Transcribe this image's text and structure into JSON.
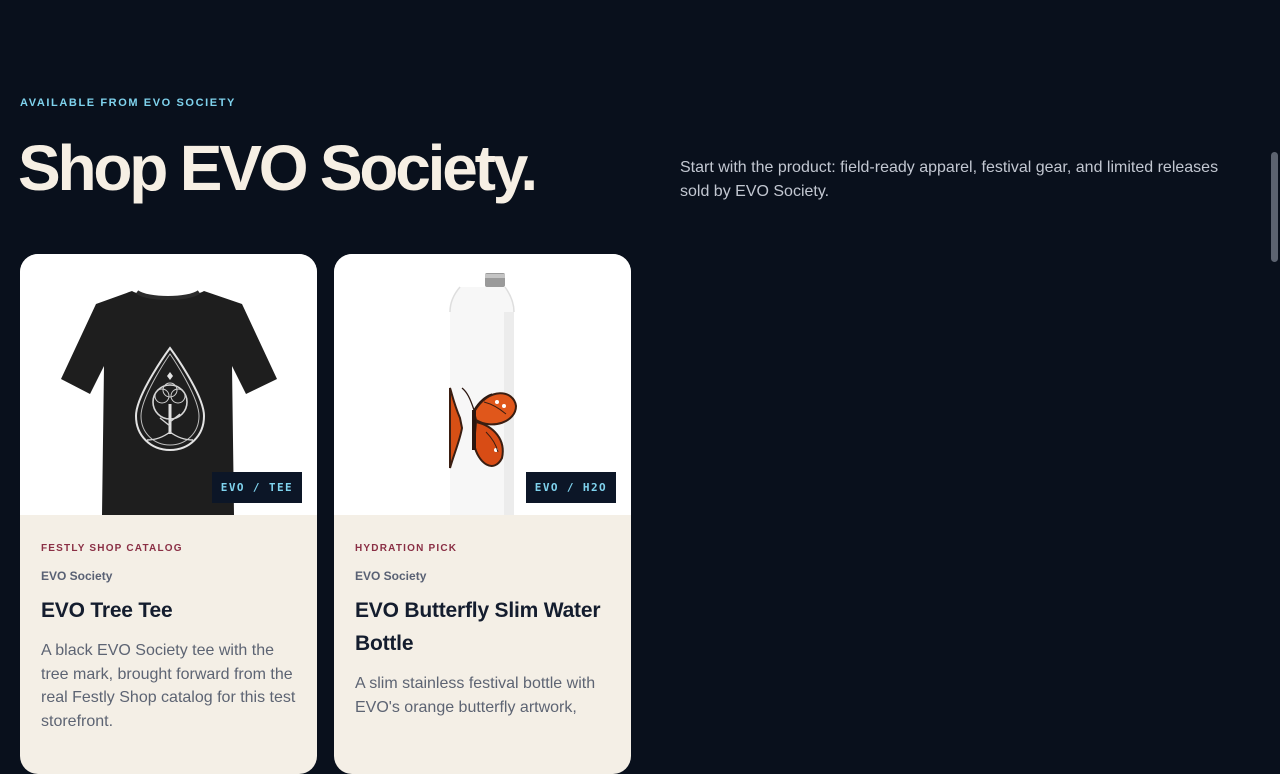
{
  "hero": {
    "eyebrow": "AVAILABLE FROM EVO SOCIETY",
    "headline": "Shop EVO Society.",
    "intro": "Start with the product: field-ready apparel, festival gear, and limited releases sold by EVO Society."
  },
  "products": [
    {
      "image_icon": "tshirt-tree-icon",
      "tag": "EVO / TEE",
      "kicker": "FESTLY SHOP CATALOG",
      "brand": "EVO Society",
      "title": "EVO Tree Tee",
      "description": "A black EVO Society tee with the tree mark, brought forward from the real Festly Shop catalog for this test storefront."
    },
    {
      "image_icon": "butterfly-bottle-icon",
      "tag": "EVO / H2O",
      "kicker": "HYDRATION PICK",
      "brand": "EVO Society",
      "title": "EVO Butterfly Slim Water Bottle",
      "description": "A slim stainless festival bottle with EVO's orange butterfly artwork,"
    }
  ],
  "colors": {
    "background": "#09101c",
    "accent": "#7fd3ee",
    "headline": "#f6efe4",
    "card_surface": "#f4efe6",
    "kicker": "#8a2f45"
  }
}
